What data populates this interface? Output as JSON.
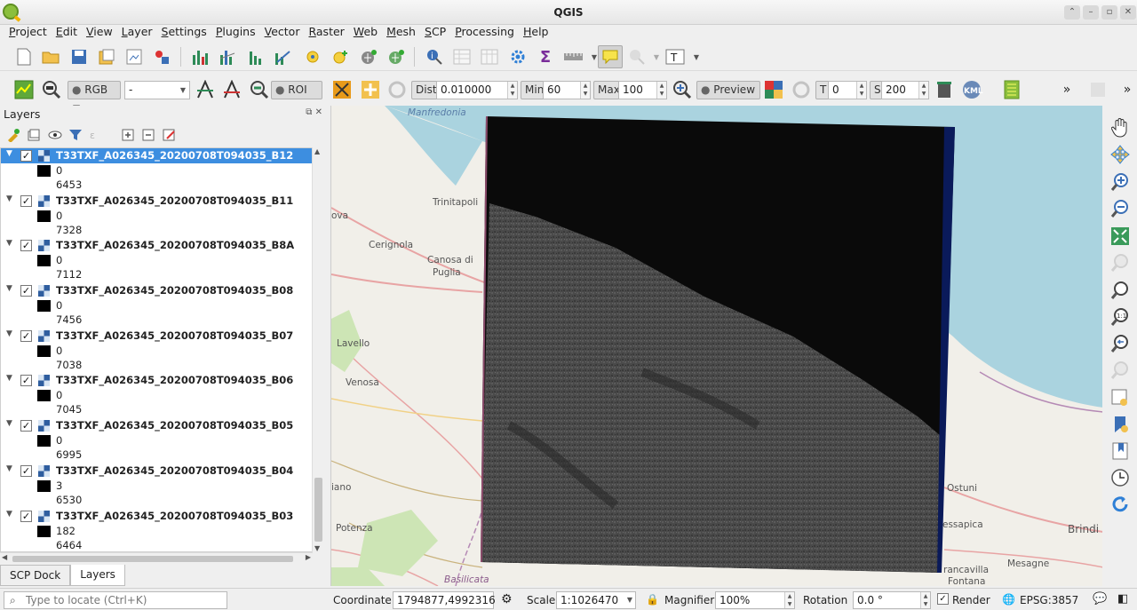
{
  "window": {
    "title": "QGIS",
    "controls": [
      "⌃",
      "–",
      "▫",
      "✕"
    ]
  },
  "menu": [
    "Project",
    "Edit",
    "View",
    "Layer",
    "Settings",
    "Plugins",
    "Vector",
    "Raster",
    "Web",
    "Mesh",
    "SCP",
    "Processing",
    "Help"
  ],
  "scp_toolbar": {
    "rgb_label": "RGB =",
    "rgb_value": "-",
    "roi_label": "ROI",
    "dist_label": "Dist",
    "dist_value": "0.010000",
    "min_label": "Min",
    "min_value": "60",
    "max_label": "Max",
    "max_value": "100",
    "preview_label": "Preview",
    "t_label": "T",
    "t_value": "0",
    "s_label": "S",
    "s_value": "200",
    "kml_label": "KML",
    "more_label": "»"
  },
  "text_tool_label": "T",
  "layers_panel": {
    "title": "Layers",
    "layers": [
      {
        "name": "T33TXF_A026345_20200708T094035_B12",
        "min": "0",
        "max": "6453",
        "selected": true
      },
      {
        "name": "T33TXF_A026345_20200708T094035_B11",
        "min": "0",
        "max": "7328",
        "selected": false
      },
      {
        "name": "T33TXF_A026345_20200708T094035_B8A",
        "min": "0",
        "max": "7112",
        "selected": false
      },
      {
        "name": "T33TXF_A026345_20200708T094035_B08",
        "min": "0",
        "max": "7456",
        "selected": false
      },
      {
        "name": "T33TXF_A026345_20200708T094035_B07",
        "min": "0",
        "max": "7038",
        "selected": false
      },
      {
        "name": "T33TXF_A026345_20200708T094035_B06",
        "min": "0",
        "max": "7045",
        "selected": false
      },
      {
        "name": "T33TXF_A026345_20200708T094035_B05",
        "min": "0",
        "max": "6995",
        "selected": false
      },
      {
        "name": "T33TXF_A026345_20200708T094035_B04",
        "min": "3",
        "max": "6530",
        "selected": false
      },
      {
        "name": "T33TXF_A026345_20200708T094035_B03",
        "min": "182",
        "max": "6464",
        "selected": false
      }
    ]
  },
  "dock_tabs": [
    "SCP Dock",
    "Layers"
  ],
  "map_places": {
    "manfredonia": "Manfredonia",
    "trinitapoli": "Trinitapoli",
    "cerignola": "Cerignola",
    "canosa": "Canosa di",
    "puglia": "Puglia",
    "lavello": "Lavello",
    "venosa": "Venosa",
    "ova": "ova",
    "iano": "iano",
    "potenza": "Potenza",
    "basilicata": "Basilicata",
    "ostuni": "Ostuni",
    "essapica": "essapica",
    "brindisi": "Brindi",
    "mesagne": "Mesagne",
    "francavilla": "rancavilla",
    "fontana": "Fontana"
  },
  "statusbar": {
    "locate_placeholder": "Type to locate (Ctrl+K)",
    "coordinate_label": "Coordinate",
    "coordinate_value": "1794877,4992316",
    "scale_label": "Scale",
    "scale_value": "1:1026470",
    "magnifier_label": "Magnifier",
    "magnifier_value": "100%",
    "rotation_label": "Rotation",
    "rotation_value": "0.0 °",
    "render_label": "Render",
    "crs_label": "EPSG:3857"
  },
  "colors": {
    "selection": "#3d8ee0",
    "sea": "#aad3df",
    "land": "#f1efe9"
  }
}
